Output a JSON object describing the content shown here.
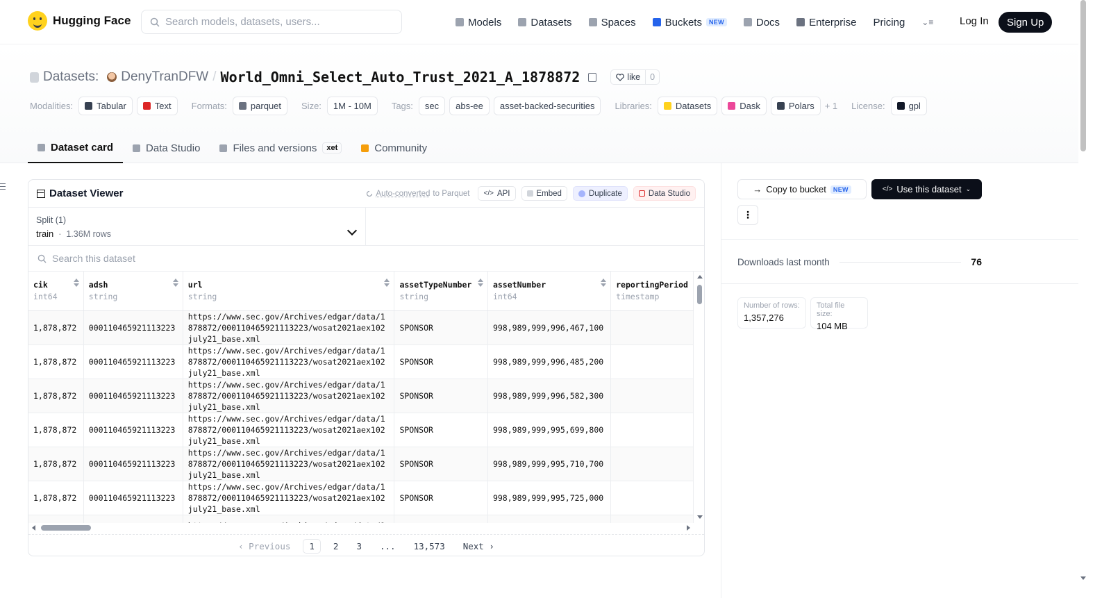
{
  "brand": {
    "name": "Hugging Face"
  },
  "search": {
    "placeholder": "Search models, datasets, users..."
  },
  "nav": {
    "items": [
      {
        "label": "Models",
        "icon": "cube-icon",
        "color": "#9ca3af"
      },
      {
        "label": "Datasets",
        "icon": "database-icon",
        "color": "#9ca3af"
      },
      {
        "label": "Spaces",
        "icon": "grid-icon",
        "color": "#9ca3af"
      },
      {
        "label": "Buckets",
        "icon": "bucket-icon",
        "color": "#2563eb",
        "badge": "NEW"
      },
      {
        "label": "Docs",
        "icon": "book-icon",
        "color": "#9ca3af"
      },
      {
        "label": "Enterprise",
        "icon": "briefcase-icon",
        "color": "#6b7280"
      },
      {
        "label": "Pricing"
      }
    ],
    "login": "Log In",
    "signup": "Sign Up"
  },
  "header": {
    "type_label": "Datasets:",
    "owner": "DenyTranDFW",
    "separator": "/",
    "name": "World_Omni_Select_Auto_Trust_2021_A_1878872",
    "like_label": "like",
    "like_count": "0"
  },
  "meta": {
    "modalities_label": "Modalities:",
    "modalities": [
      {
        "label": "Tabular",
        "icon_color": "#374151"
      },
      {
        "label": "Text",
        "icon_color": "#dc2626"
      }
    ],
    "formats_label": "Formats:",
    "formats": [
      "parquet"
    ],
    "size_label": "Size:",
    "size": "1M - 10M",
    "tags_label": "Tags:",
    "tags": [
      "sec",
      "abs-ee",
      "asset-backed-securities"
    ],
    "libraries_label": "Libraries:",
    "libraries": [
      {
        "label": "Datasets",
        "icon_color": "#ffd21e"
      },
      {
        "label": "Dask",
        "icon_color": "#ec4899"
      },
      {
        "label": "Polars",
        "icon_color": "#374151"
      }
    ],
    "libraries_more": "+ 1",
    "license_label": "License:",
    "license": "gpl"
  },
  "tabs": [
    {
      "label": "Dataset card",
      "active": true
    },
    {
      "label": "Data Studio"
    },
    {
      "label": "Files and versions",
      "badge": "xet"
    },
    {
      "label": "Community"
    }
  ],
  "viewer": {
    "title": "Dataset Viewer",
    "auto_converted_link": "Auto-converted",
    "auto_converted_rest": "to Parquet",
    "buttons": {
      "api": "API",
      "embed": "Embed",
      "duplicate": "Duplicate",
      "data_studio": "Data Studio"
    },
    "split_label": "Split (1)",
    "split_value": "train",
    "split_rows": "1.36M rows",
    "search_placeholder": "Search this dataset",
    "columns": [
      {
        "name": "cik",
        "type": "int64"
      },
      {
        "name": "adsh",
        "type": "string"
      },
      {
        "name": "url",
        "type": "string"
      },
      {
        "name": "assetTypeNumber",
        "type": "string"
      },
      {
        "name": "assetNumber",
        "type": "int64"
      },
      {
        "name": "reportingPeriod",
        "type": "timestamp"
      }
    ],
    "rows": [
      {
        "cik": "1,878,872",
        "adsh": "000110465921113223",
        "url": "https://www.sec.gov/Archives/edgar/data/1878872/000110465921113223/wosat2021aex102july21_base.xml",
        "assetTypeNumber": "SPONSOR",
        "assetNumber": "998,989,999,996,467,100"
      },
      {
        "cik": "1,878,872",
        "adsh": "000110465921113223",
        "url": "https://www.sec.gov/Archives/edgar/data/1878872/000110465921113223/wosat2021aex102july21_base.xml",
        "assetTypeNumber": "SPONSOR",
        "assetNumber": "998,989,999,996,485,200"
      },
      {
        "cik": "1,878,872",
        "adsh": "000110465921113223",
        "url": "https://www.sec.gov/Archives/edgar/data/1878872/000110465921113223/wosat2021aex102july21_base.xml",
        "assetTypeNumber": "SPONSOR",
        "assetNumber": "998,989,999,996,582,300"
      },
      {
        "cik": "1,878,872",
        "adsh": "000110465921113223",
        "url": "https://www.sec.gov/Archives/edgar/data/1878872/000110465921113223/wosat2021aex102july21_base.xml",
        "assetTypeNumber": "SPONSOR",
        "assetNumber": "998,989,999,995,699,800"
      },
      {
        "cik": "1,878,872",
        "adsh": "000110465921113223",
        "url": "https://www.sec.gov/Archives/edgar/data/1878872/000110465921113223/wosat2021aex102july21_base.xml",
        "assetTypeNumber": "SPONSOR",
        "assetNumber": "998,989,999,995,710,700"
      },
      {
        "cik": "1,878,872",
        "adsh": "000110465921113223",
        "url": "https://www.sec.gov/Archives/edgar/data/1878872/000110465921113223/wosat2021aex102july21_base.xml",
        "assetTypeNumber": "SPONSOR",
        "assetNumber": "998,989,999,995,725,000"
      },
      {
        "cik": "",
        "adsh": "",
        "url": "https://www.sec.gov/Archives/edgar/data/1878872/00",
        "assetTypeNumber": "",
        "assetNumber": ""
      }
    ],
    "pager": {
      "previous": "Previous",
      "pages": [
        "1",
        "2",
        "3",
        "...",
        "13,573"
      ],
      "current": "1",
      "next": "Next"
    }
  },
  "sidebar": {
    "copy_to_bucket": "Copy to bucket",
    "copy_badge": "NEW",
    "use_dataset": "Use this dataset",
    "more": "⋮",
    "downloads_label": "Downloads last month",
    "downloads_value": "76",
    "rows_label": "Number of rows:",
    "rows_value": "1,357,276",
    "size_label": "Total file size:",
    "size_value": "104 MB"
  }
}
